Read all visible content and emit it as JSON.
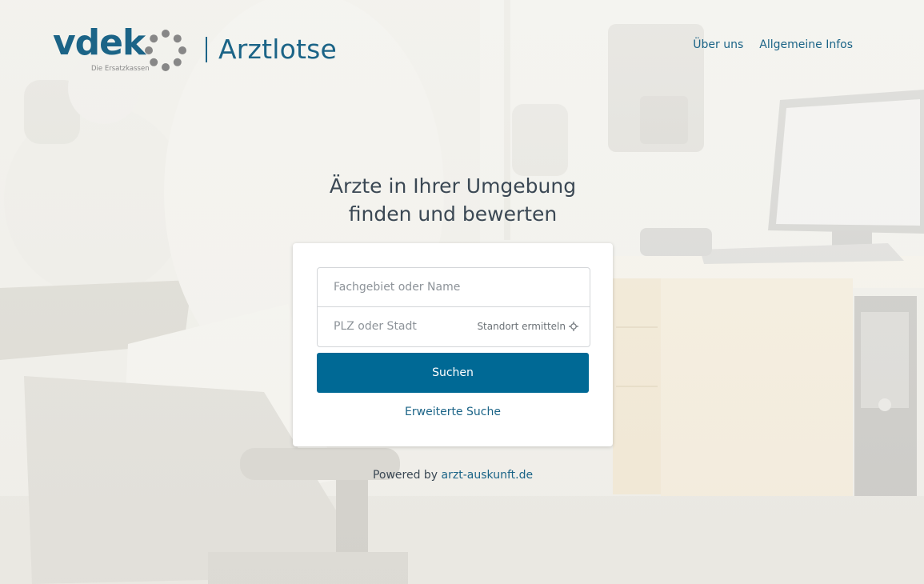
{
  "header": {
    "logo_text": "vdek",
    "logo_subtitle": "Die Ersatzkassen",
    "product_name": "Arztlotse",
    "brand_color": "#1b6487",
    "nav": [
      {
        "label": "Über uns"
      },
      {
        "label": "Allgemeine Infos"
      }
    ]
  },
  "hero": {
    "headline_line1": "Ärzte in Ihrer Umgebung",
    "headline_line2": "finden und bewerten"
  },
  "search": {
    "specialty_placeholder": "Fachgebiet oder Name",
    "specialty_value": "",
    "location_placeholder": "PLZ oder Stadt",
    "location_value": "",
    "locate_label": "Standort ermitteln",
    "locate_icon": "crosshair-icon",
    "submit_label": "Suchen",
    "submit_color": "#006995",
    "advanced_label": "Erweiterte Suche"
  },
  "footer": {
    "powered_prefix": "Powered by",
    "powered_link": "arzt-auskunft.de"
  }
}
